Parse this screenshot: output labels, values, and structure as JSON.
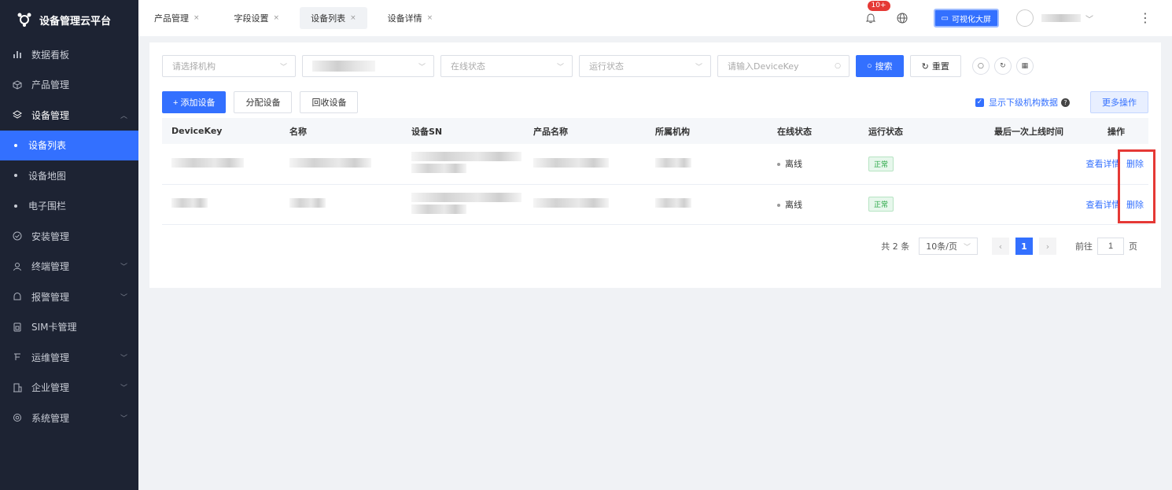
{
  "app": {
    "title": "设备管理云平台"
  },
  "sidebar": {
    "items": [
      {
        "label": "数据看板",
        "icon": "bar-chart-icon"
      },
      {
        "label": "产品管理",
        "icon": "cube-icon"
      },
      {
        "label": "设备管理",
        "icon": "layers-icon",
        "expanded": true,
        "children": [
          {
            "label": "设备列表",
            "active": true
          },
          {
            "label": "设备地图"
          },
          {
            "label": "电子围栏"
          }
        ]
      },
      {
        "label": "安装管理",
        "icon": "check-circle-icon"
      },
      {
        "label": "终端管理",
        "icon": "user-icon"
      },
      {
        "label": "报警管理",
        "icon": "alarm-icon"
      },
      {
        "label": "SIM卡管理",
        "icon": "sim-icon"
      },
      {
        "label": "运维管理",
        "icon": "tool-icon"
      },
      {
        "label": "企业管理",
        "icon": "building-icon"
      },
      {
        "label": "系统管理",
        "icon": "settings-icon"
      }
    ]
  },
  "tabs": [
    {
      "label": "产品管理"
    },
    {
      "label": "字段设置"
    },
    {
      "label": "设备列表",
      "active": true
    },
    {
      "label": "设备详情"
    }
  ],
  "topbar": {
    "notification_badge": "10+",
    "big_screen_label": "可视化大屏"
  },
  "filters": {
    "org_placeholder": "请选择机构",
    "online_placeholder": "在线状态",
    "run_placeholder": "运行状态",
    "devicekey_placeholder": "请输入DeviceKey",
    "search_label": "搜索",
    "reset_label": "重置"
  },
  "actions": {
    "add_label": "+ 添加设备",
    "assign_label": "分配设备",
    "recycle_label": "回收设备",
    "show_sub_label": "显示下级机构数据",
    "more_label": "更多操作"
  },
  "table": {
    "headers": [
      "DeviceKey",
      "名称",
      "设备SN",
      "产品名称",
      "所属机构",
      "在线状态",
      "运行状态",
      "最后一次上线时间",
      "操作"
    ],
    "rows": [
      {
        "online": "离线",
        "run": "正常",
        "view": "查看详情",
        "delete": "删除"
      },
      {
        "online": "离线",
        "run": "正常",
        "view": "查看详情",
        "delete": "删除"
      }
    ]
  },
  "pagination": {
    "total": "共 2 条",
    "page_size": "10条/页",
    "current_page": "1",
    "goto_label": "前往",
    "goto_value": "1",
    "page_suffix": "页"
  },
  "colors": {
    "primary": "#3370ff",
    "sidebar_bg": "#1d2333",
    "highlight": "#e53935"
  }
}
